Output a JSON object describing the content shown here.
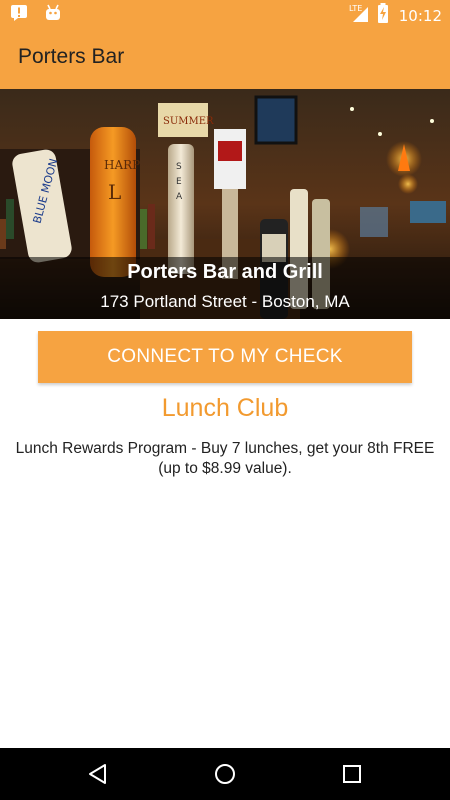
{
  "status_bar": {
    "time": "10:12",
    "network": "LTE",
    "icons": [
      "notification-icon",
      "android-icon",
      "signal-icon",
      "battery-icon"
    ]
  },
  "app_bar": {
    "title": "Porters Bar"
  },
  "hero": {
    "venue_name": "Porters Bar and Grill",
    "address": "173 Portland Street - Boston, MA"
  },
  "actions": {
    "connect_label": "CONNECT TO MY CHECK"
  },
  "promo": {
    "title": "Lunch Club",
    "description": "Lunch Rewards Program - Buy 7 lunches, get your 8th FREE (up to $8.99 value)."
  },
  "nav": {
    "icons": [
      "back-icon",
      "home-icon",
      "recents-icon"
    ]
  },
  "colors": {
    "accent": "#f6a341",
    "promo_title": "#f29a2f"
  }
}
